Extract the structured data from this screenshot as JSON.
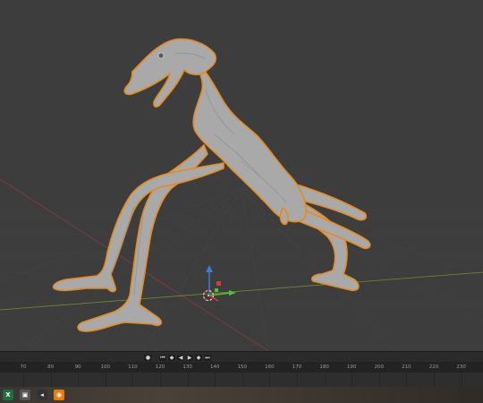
{
  "app": {
    "name": "Blender"
  },
  "playback": {
    "record_icon": "record-icon",
    "buttons": [
      {
        "name": "jump-to-start-icon",
        "glyph": "⏮"
      },
      {
        "name": "jump-to-keyframe-back-icon",
        "glyph": "◆"
      },
      {
        "name": "play-reverse-icon",
        "glyph": "◀"
      },
      {
        "name": "play-icon",
        "glyph": "▶"
      },
      {
        "name": "jump-to-keyframe-forward-icon",
        "glyph": "◆"
      },
      {
        "name": "jump-to-end-icon",
        "glyph": "⏭"
      }
    ]
  },
  "timeline": {
    "ticks": [
      "70",
      "80",
      "90",
      "100",
      "110",
      "120",
      "130",
      "140",
      "150",
      "160",
      "170",
      "180",
      "190",
      "200",
      "210",
      "220",
      "230"
    ]
  },
  "taskbar": {
    "apps": [
      {
        "name": "excel-icon",
        "label": "X",
        "color": "#1d6f42"
      },
      {
        "name": "cube-app-icon",
        "label": "▣",
        "color": "#555555"
      },
      {
        "name": "terminal-icon",
        "label": "◂",
        "color": "#333333"
      },
      {
        "name": "blender-icon",
        "label": "◉",
        "color": "#e87d0d"
      }
    ]
  },
  "colors": {
    "selection_outline": "#e88a1a",
    "x_axis": "#8a3b3b",
    "y_axis": "#6f8f2a",
    "gizmo_z": "#3b7bd6",
    "gizmo_y": "#4fbf3f",
    "gizmo_x": "#d43b3b"
  }
}
